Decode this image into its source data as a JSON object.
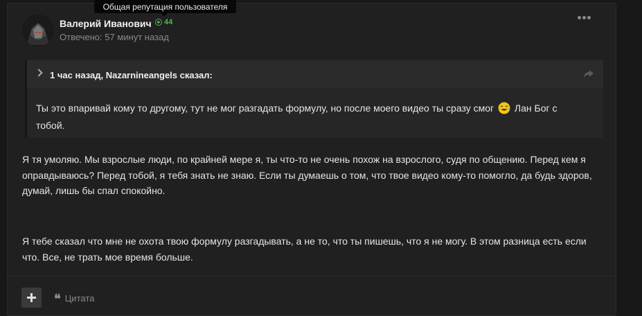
{
  "tooltip": {
    "text": "Общая репутация пользователя"
  },
  "post": {
    "author": "Валерий Иванович",
    "reputation": "44",
    "answered": "Отвечено: 57 минут назад",
    "quote": {
      "citation": "1 час назад, Nazarnineangels сказал:",
      "text_before_emoji": "Ты это впаривай кому то другому, тут не мог разгадать формулу, но после моего видео ты сразу смог",
      "text_after_emoji": " Лан Бог с тобой."
    },
    "paragraphs": [
      "Я тя умоляю. Мы взрослые люди, по крайней мере я, ты что-то не очень похож на взрослого, судя по общению. Перед кем я оправдываюсь? Перед тобой, я тебя знать не знаю. Если ты думаешь о том, что твое видео кому-то помогло, да будь здоров, думай, лишь бы спал спокойно.",
      "Я тебе сказал что мне не охота твою формулу разгадывать, а не то, что ты пишешь, что я не могу. В этом разница есть если что. Все, не трать мое время больше."
    ]
  },
  "actions": {
    "quote_label": "Цитата"
  },
  "icons": {
    "reputation": "plus-circle-icon",
    "more": "more-horizontal-icon",
    "collapse": "chevron-down-icon",
    "share": "share-arrow-icon",
    "emoji": "laughing-tears-emoji",
    "quote": "quote-mark-icon",
    "add": "plus-icon"
  },
  "colors": {
    "reputation": "#4cb650",
    "background": "#181818",
    "post_bg": "#202020",
    "quote_bg": "#262626"
  }
}
